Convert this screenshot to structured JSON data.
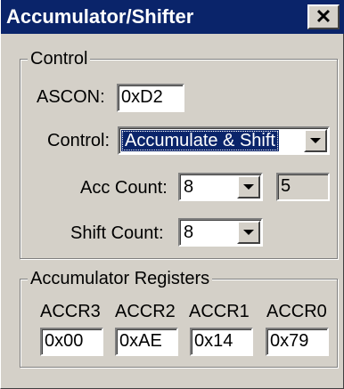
{
  "window": {
    "title": "Accumulator/Shifter",
    "close_label": "✕"
  },
  "control_group": {
    "legend": "Control",
    "ascon_label": "ASCON:",
    "ascon_value": "0xD2",
    "control_label": "Control:",
    "control_value": "Accumulate & Shift",
    "acc_count_label": "Acc Count:",
    "acc_count_value": "8",
    "acc_count_readout": "5",
    "shift_count_label": "Shift Count:",
    "shift_count_value": "8"
  },
  "registers_group": {
    "legend": "Accumulator Registers",
    "registers": [
      {
        "name": "ACCR3",
        "value": "0x00"
      },
      {
        "name": "ACCR2",
        "value": "0xAE"
      },
      {
        "name": "ACCR1",
        "value": "0x14"
      },
      {
        "name": "ACCR0",
        "value": "0x79"
      }
    ]
  },
  "colors": {
    "titlebar": "#0a246a",
    "face": "#d4d0c8",
    "selection": "#0a246a"
  },
  "icons": {
    "close": "close-icon",
    "dropdown": "chevron-down-icon"
  }
}
